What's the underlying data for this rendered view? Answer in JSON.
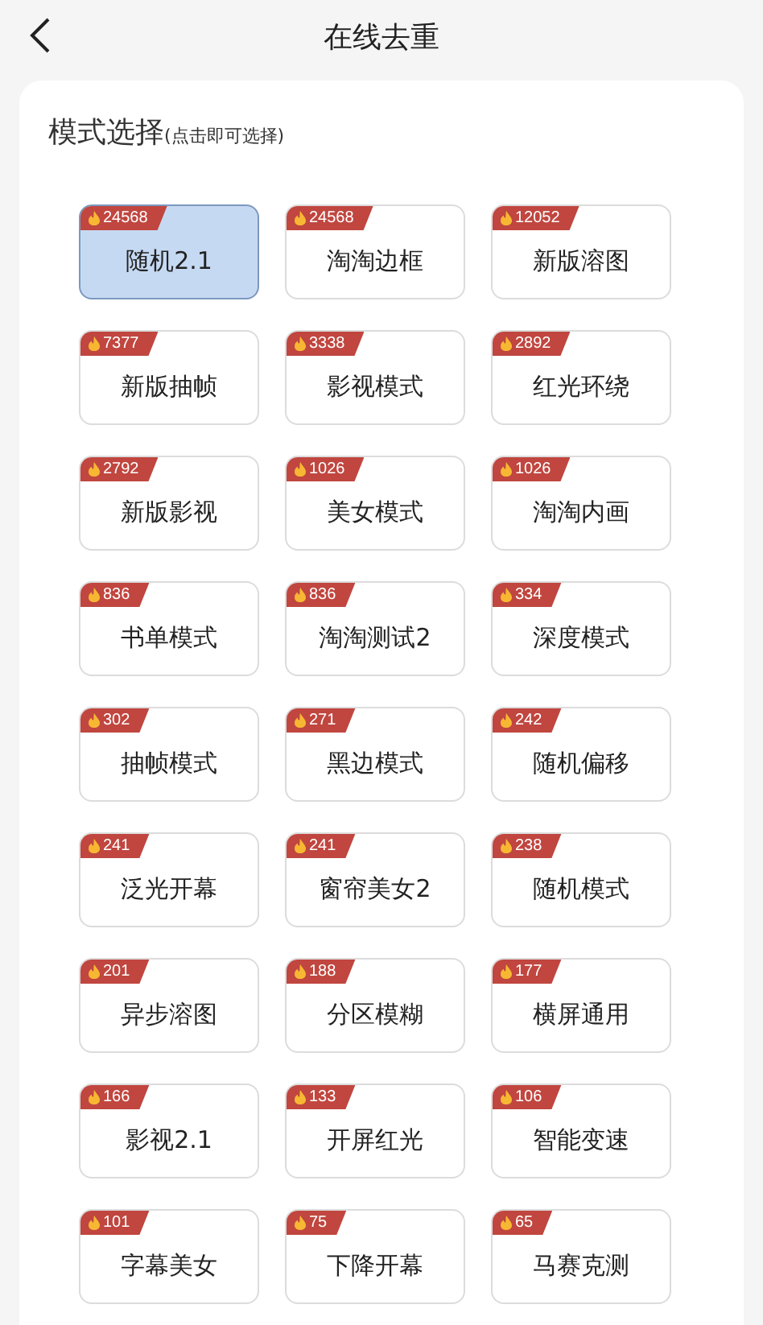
{
  "header": {
    "title": "在线去重"
  },
  "section": {
    "title": "模式选择",
    "hint": "(点击即可选择)"
  },
  "modes": [
    {
      "label": "随机2.1",
      "count": "24568",
      "selected": true
    },
    {
      "label": "淘淘边框",
      "count": "24568",
      "selected": false
    },
    {
      "label": "新版溶图",
      "count": "12052",
      "selected": false
    },
    {
      "label": "新版抽帧",
      "count": "7377",
      "selected": false
    },
    {
      "label": "影视模式",
      "count": "3338",
      "selected": false
    },
    {
      "label": "红光环绕",
      "count": "2892",
      "selected": false
    },
    {
      "label": "新版影视",
      "count": "2792",
      "selected": false
    },
    {
      "label": "美女模式",
      "count": "1026",
      "selected": false
    },
    {
      "label": "淘淘内画",
      "count": "1026",
      "selected": false
    },
    {
      "label": "书单模式",
      "count": "836",
      "selected": false
    },
    {
      "label": "淘淘测试2",
      "count": "836",
      "selected": false
    },
    {
      "label": "深度模式",
      "count": "334",
      "selected": false
    },
    {
      "label": "抽帧模式",
      "count": "302",
      "selected": false
    },
    {
      "label": "黑边模式",
      "count": "271",
      "selected": false
    },
    {
      "label": "随机偏移",
      "count": "242",
      "selected": false
    },
    {
      "label": "泛光开幕",
      "count": "241",
      "selected": false
    },
    {
      "label": "窗帘美女2",
      "count": "241",
      "selected": false
    },
    {
      "label": "随机模式",
      "count": "238",
      "selected": false
    },
    {
      "label": "异步溶图",
      "count": "201",
      "selected": false
    },
    {
      "label": "分区模糊",
      "count": "188",
      "selected": false
    },
    {
      "label": "横屏通用",
      "count": "177",
      "selected": false
    },
    {
      "label": "影视2.1",
      "count": "166",
      "selected": false
    },
    {
      "label": "开屏红光",
      "count": "133",
      "selected": false
    },
    {
      "label": "智能变速",
      "count": "106",
      "selected": false
    },
    {
      "label": "字幕美女",
      "count": "101",
      "selected": false
    },
    {
      "label": "下降开幕",
      "count": "75",
      "selected": false
    },
    {
      "label": "马赛克测",
      "count": "65",
      "selected": false
    }
  ]
}
